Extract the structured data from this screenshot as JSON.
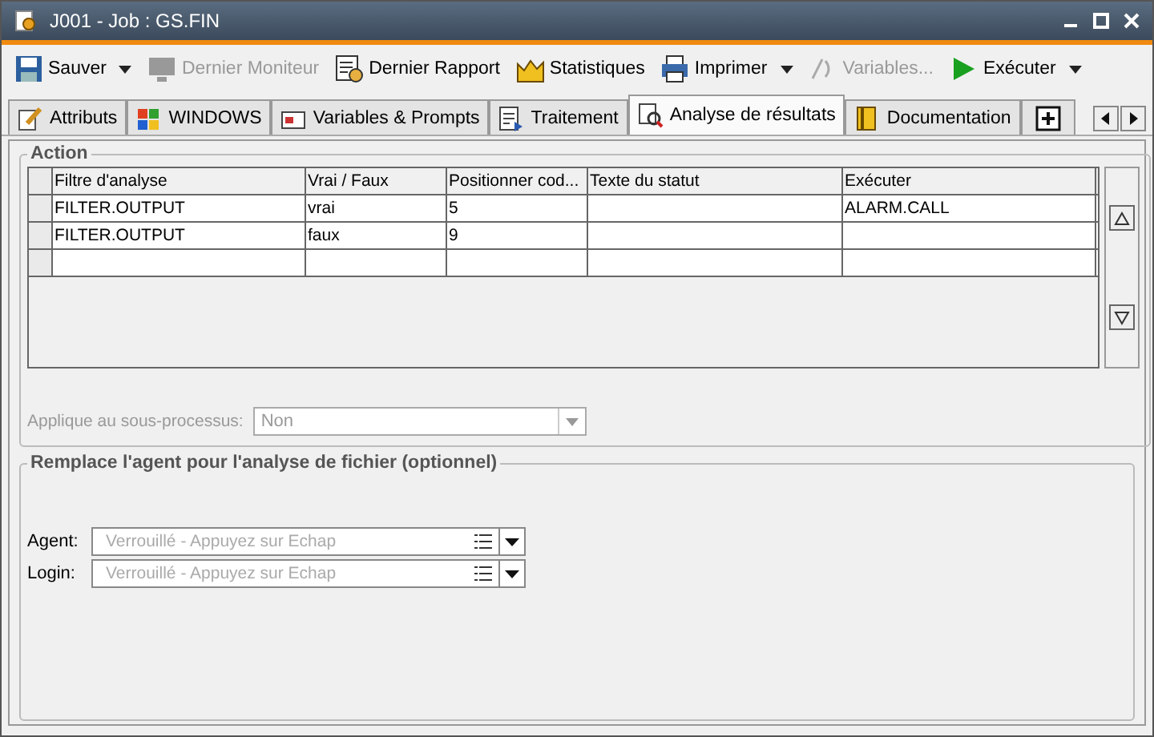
{
  "window": {
    "title": "J001 - Job : GS.FIN"
  },
  "toolbar": [
    {
      "label": "Sauver",
      "disabled": false,
      "dropdown": true
    },
    {
      "label": "Dernier Moniteur",
      "disabled": true,
      "dropdown": false
    },
    {
      "label": "Dernier Rapport",
      "disabled": false,
      "dropdown": false
    },
    {
      "label": "Statistiques",
      "disabled": false,
      "dropdown": false
    },
    {
      "label": "Imprimer",
      "disabled": false,
      "dropdown": true
    },
    {
      "label": "Variables...",
      "disabled": true,
      "dropdown": false
    },
    {
      "label": "Exécuter",
      "disabled": false,
      "dropdown": true
    }
  ],
  "tabs": [
    {
      "label": "Attributs",
      "selected": false
    },
    {
      "label": "WINDOWS",
      "selected": false
    },
    {
      "label": "Variables & Prompts",
      "selected": false
    },
    {
      "label": "Traitement",
      "selected": false
    },
    {
      "label": "Analyse de résultats",
      "selected": true
    },
    {
      "label": "Documentation",
      "selected": false
    }
  ],
  "action": {
    "title": "Action",
    "table": {
      "columns": [
        "Filtre d'analyse",
        "Vrai / Faux",
        "Positionner cod...",
        "Texte du statut",
        "Exécuter"
      ],
      "rows": [
        {
          "filtre": "FILTER.OUTPUT",
          "vrai_faux": "vrai",
          "code": "5",
          "executer": "ALARM.CALL"
        },
        {
          "filtre": "FILTER.OUTPUT",
          "vrai_faux": "faux",
          "code": "9"
        }
      ]
    },
    "subprocess": {
      "label": "Applique au sous-processus:",
      "value": "Non",
      "disabled": true
    }
  },
  "agent_override": {
    "title": "Remplace l'agent pour l'analyse de fichier (optionnel)",
    "fields": [
      {
        "label": "Agent:",
        "placeholder": "Verrouillé - Appuyez sur Echap"
      },
      {
        "label": "Login:",
        "placeholder": "Verrouillé - Appuyez sur Echap"
      }
    ]
  }
}
